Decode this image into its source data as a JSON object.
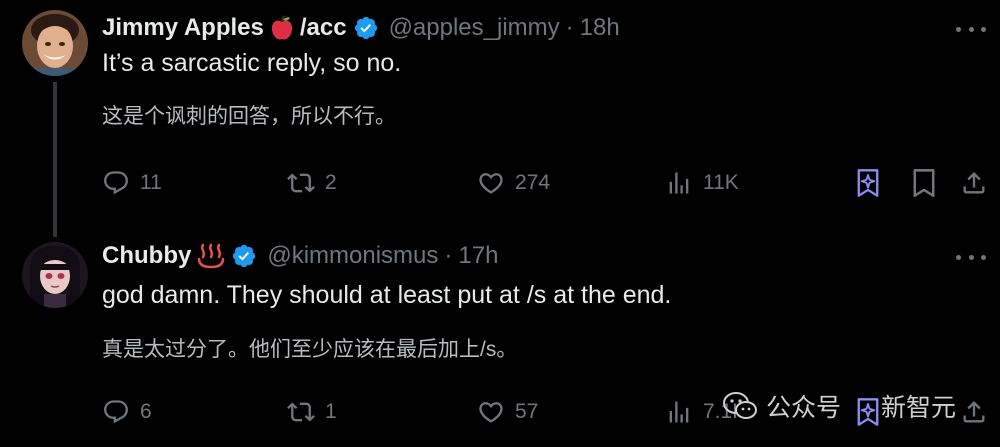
{
  "tweets": [
    {
      "author_name": "Jimmy Apples",
      "name_emoji": "🍎",
      "name_suffix": "/acc",
      "handle": "@apples_jimmy",
      "time": "18h",
      "text": "It’s a sarcastic reply, so no.",
      "translation": "这是个讽刺的回答，所以不行。",
      "replies": "11",
      "reposts": "2",
      "likes": "274",
      "views": "11K",
      "avatar_bg": "#8a5a3c"
    },
    {
      "author_name": "Chubby",
      "name_emoji": "♨️",
      "handle": "@kimmonismus",
      "time": "17h",
      "text": "god damn. They should at least put at /s at the end.",
      "translation": "真是太过分了。他们至少应该在最后加上/s。",
      "replies": "6",
      "reposts": "1",
      "likes": "57",
      "views": "7.1K",
      "avatar_bg": "#2a1c2a"
    }
  ],
  "colors": {
    "background": "#000000",
    "text": "#e7e9ea",
    "muted": "#71767b",
    "verified": "#1d9bf0",
    "grok": "#8f8cf5",
    "divider": "#333639"
  },
  "watermark": {
    "icon": "wechat-icon",
    "text": "公众号",
    "brand": "新智元"
  }
}
